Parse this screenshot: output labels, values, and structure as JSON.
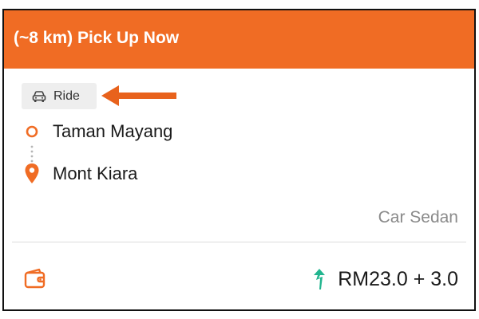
{
  "header": {
    "title": "(~8 km) Pick Up Now",
    "color": "#f06c24"
  },
  "badge": {
    "icon": "car-icon",
    "label": "Ride"
  },
  "annotation": {
    "icon": "arrow-left-icon",
    "color": "#e8621c"
  },
  "route": {
    "pickup": {
      "icon": "hollow-circle-icon",
      "label": "Taman Mayang"
    },
    "dropoff": {
      "icon": "map-pin-icon",
      "label": "Mont Kiara"
    },
    "connector_icon": "dotted-line-icon"
  },
  "vehicle": {
    "type": "Car Sedan"
  },
  "payment": {
    "icon": "wallet-icon",
    "surge_icon": "surge-arrow-icon",
    "surge_color": "#22b58f",
    "fare": "RM23.0 + 3.0"
  }
}
